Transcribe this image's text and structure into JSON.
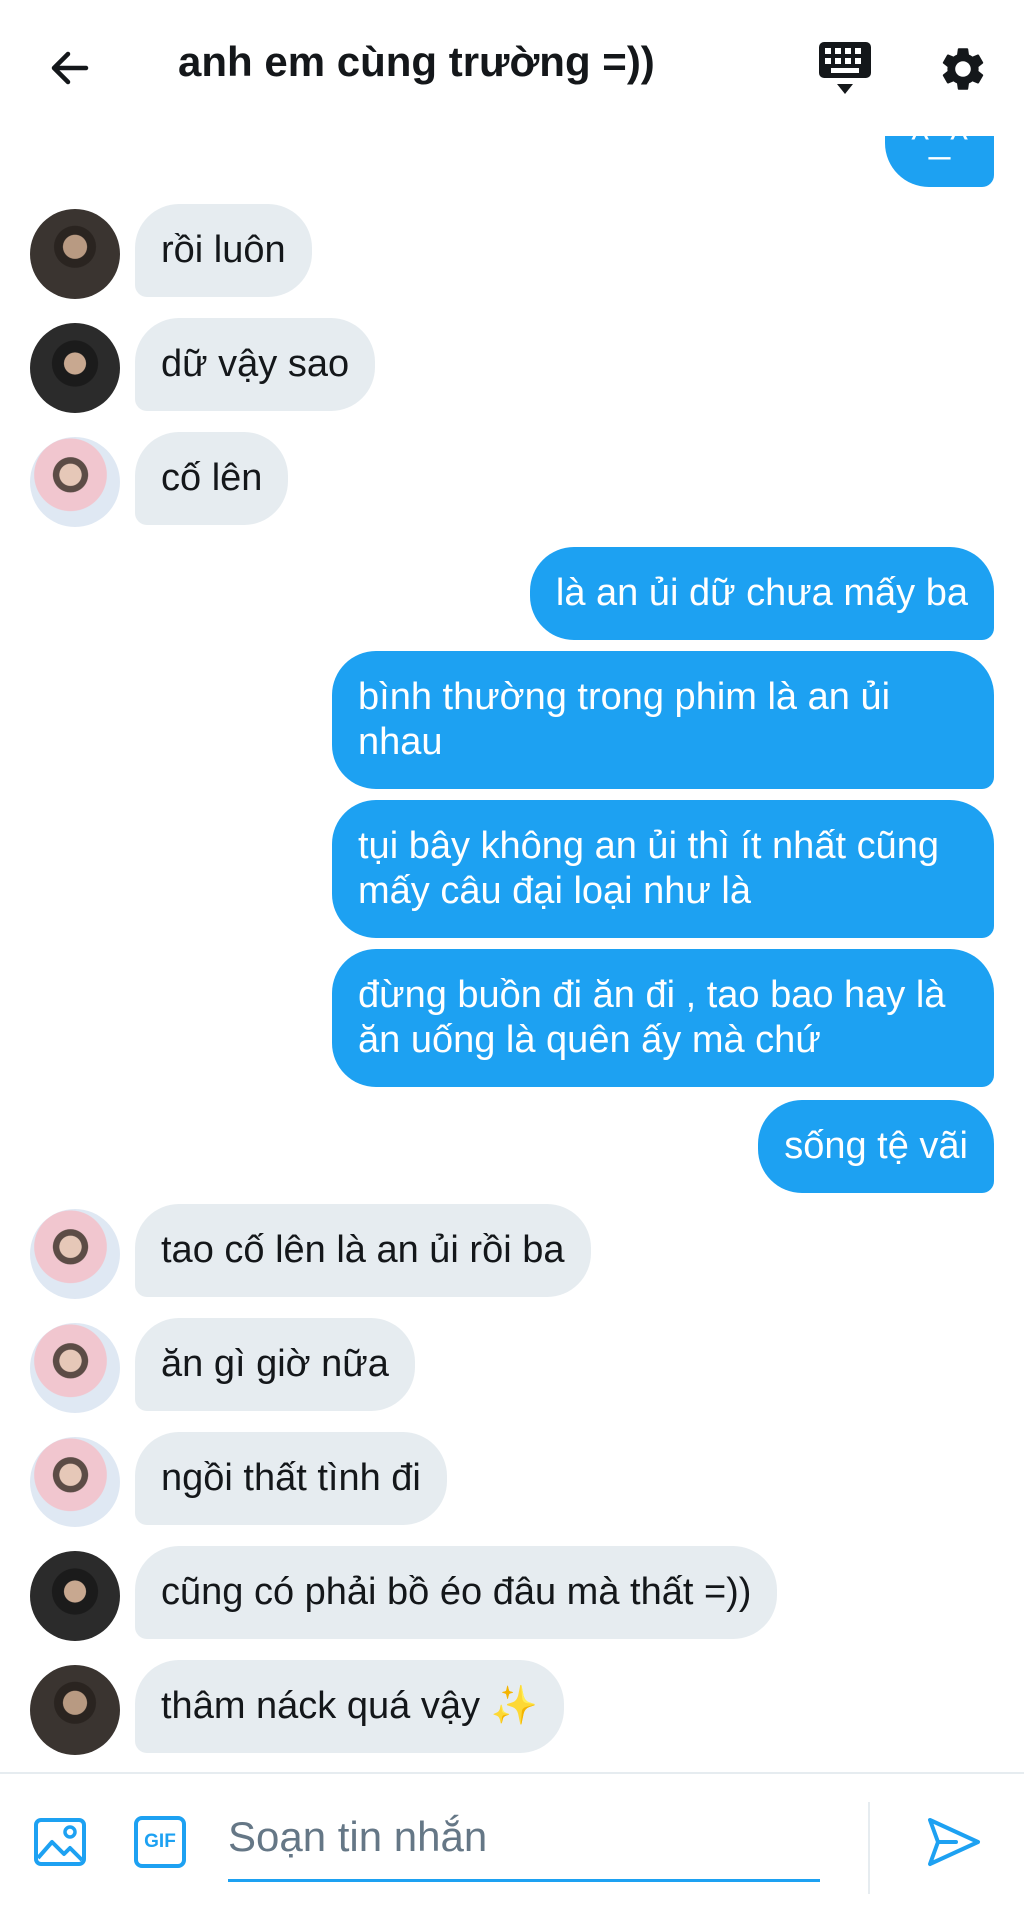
{
  "header": {
    "title": "anh em cùng trường =))",
    "back_icon": "arrow-left-icon",
    "keyboard_icon": "keyboard-icon",
    "settings_icon": "gear-icon"
  },
  "colors": {
    "accent": "#1da1f2",
    "incoming_bubble": "#e6ecf0",
    "text": "#14171a",
    "placeholder": "#657786"
  },
  "messages": [
    {
      "dir": "out",
      "text": "^_^"
    },
    {
      "dir": "in",
      "avatar": "avatar-dark",
      "text": "rồi luôn"
    },
    {
      "dir": "in",
      "avatar": "avatar-dark2",
      "text": "dữ vậy sao"
    },
    {
      "dir": "in",
      "avatar": "avatar-pink",
      "text": "cố lên"
    },
    {
      "dir": "out",
      "text": "là an ủi dữ chưa mấy ba"
    },
    {
      "dir": "out",
      "text": "bình thường trong phim là an ủi nhau"
    },
    {
      "dir": "out",
      "text": "tụi bây không an ủi thì ít nhất cũng mấy câu đại loại như là"
    },
    {
      "dir": "out",
      "text": "đừng buồn đi ăn đi , tao bao hay là ăn uống là quên ấy mà chứ"
    },
    {
      "dir": "out",
      "text": "sống tệ vãi"
    },
    {
      "dir": "in",
      "avatar": "avatar-pink",
      "text": "tao cố lên là an ủi rồi ba"
    },
    {
      "dir": "in",
      "avatar": "avatar-pink",
      "text": "ăn gì giờ nữa"
    },
    {
      "dir": "in",
      "avatar": "avatar-pink",
      "text": "ngồi thất tình đi"
    },
    {
      "dir": "in",
      "avatar": "avatar-dark2",
      "text": "cũng có phải bồ éo đâu mà thất =))"
    },
    {
      "dir": "in",
      "avatar": "avatar-dark",
      "text": "thâm náck quá vậy ✨"
    }
  ],
  "composer": {
    "placeholder": "Soạn tin nhắn",
    "value": "",
    "image_icon": "image-icon",
    "gif_label": "GIF",
    "send_icon": "send-icon"
  }
}
